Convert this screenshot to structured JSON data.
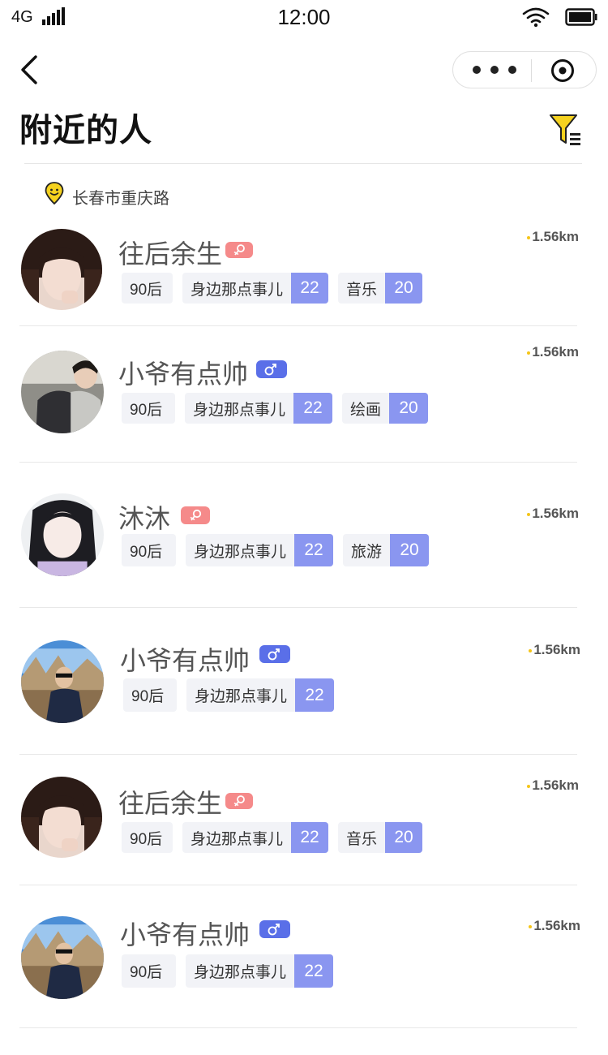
{
  "status_bar": {
    "network": "4G",
    "time": "12:00"
  },
  "header": {
    "title": "附近的人"
  },
  "location": {
    "text": "长春市重庆路"
  },
  "colors": {
    "accent": "#f5d21f",
    "female": "#f58a8a",
    "male": "#5a6fe8",
    "count_bg": "#8a96f0",
    "tag_bg": "#f2f3f7"
  },
  "people": [
    {
      "name": "往后余生",
      "gender": "female",
      "distance": "1.56km",
      "tags": [
        {
          "label": "90后"
        },
        {
          "label": "身边那点事儿",
          "count": "22"
        },
        {
          "label": "音乐",
          "count": "20"
        }
      ]
    },
    {
      "name": "小爷有点帅",
      "gender": "male",
      "distance": "1.56km",
      "tags": [
        {
          "label": "90后"
        },
        {
          "label": "身边那点事儿",
          "count": "22"
        },
        {
          "label": "绘画",
          "count": "20"
        }
      ]
    },
    {
      "name": "沐沐",
      "gender": "female",
      "distance": "1.56km",
      "tags": [
        {
          "label": "90后"
        },
        {
          "label": "身边那点事儿",
          "count": "22"
        },
        {
          "label": "旅游",
          "count": "20"
        }
      ]
    },
    {
      "name": "小爷有点帅",
      "gender": "male",
      "distance": "1.56km",
      "tags": [
        {
          "label": "90后"
        },
        {
          "label": "身边那点事儿",
          "count": "22"
        }
      ]
    },
    {
      "name": "往后余生",
      "gender": "female",
      "distance": "1.56km",
      "tags": [
        {
          "label": "90后"
        },
        {
          "label": "身边那点事儿",
          "count": "22"
        },
        {
          "label": "音乐",
          "count": "20"
        }
      ]
    },
    {
      "name": "小爷有点帅",
      "gender": "male",
      "distance": "1.56km",
      "tags": [
        {
          "label": "90后"
        },
        {
          "label": "身边那点事儿",
          "count": "22"
        }
      ]
    }
  ]
}
